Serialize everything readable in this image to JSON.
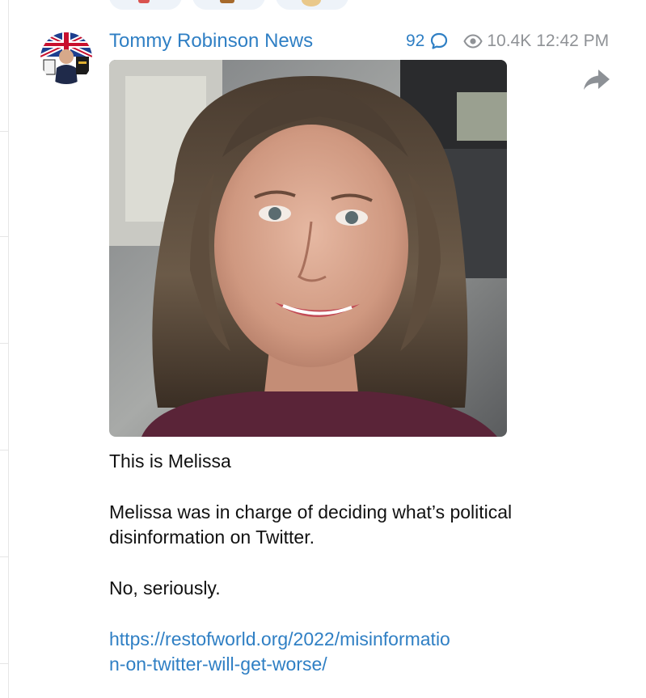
{
  "post": {
    "channel_name": "Tommy Robinson News",
    "comments_count": "92",
    "views": "10.4K",
    "time": "12:42 PM",
    "icons": {
      "comment": "comment-bubble-icon",
      "views": "eye-icon",
      "share": "share-arrow-icon"
    },
    "text": {
      "line1": "This is Melissa",
      "line2": "Melissa was in charge of deciding what’s political disinformation on Twitter.",
      "line3": "No, seriously.",
      "link": "https://restofworld.org/2022/misinformation-on-twitter-will-get-worse/"
    }
  },
  "colors": {
    "link": "#2f7fc4",
    "meta_gray": "#8f9296",
    "reaction_bg": "#eef3f9"
  }
}
